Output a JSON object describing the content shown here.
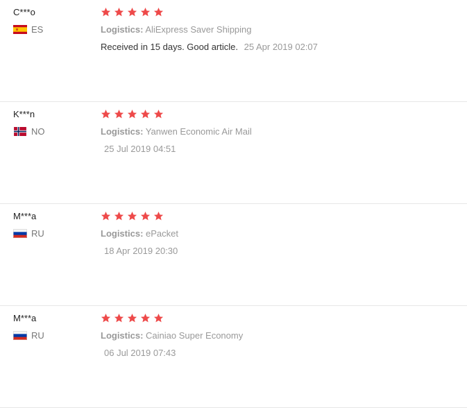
{
  "logistics_label": "Logistics:",
  "star_color": "#ee4a4a",
  "reviews": [
    {
      "user": "C***o",
      "country": "ES",
      "flag": "spain-flag",
      "rating": 5,
      "logistics": "AliExpress Saver Shipping",
      "feedback": "Received in 15 days. Good article.",
      "date": "25 Apr 2019 02:07"
    },
    {
      "user": "K***n",
      "country": "NO",
      "flag": "norway-flag",
      "rating": 5,
      "logistics": "Yanwen Economic Air Mail",
      "feedback": "",
      "date": "25 Jul 2019 04:51"
    },
    {
      "user": "M***a",
      "country": "RU",
      "flag": "russia-flag",
      "rating": 5,
      "logistics": "ePacket",
      "feedback": "",
      "date": "18 Apr 2019 20:30"
    },
    {
      "user": "M***a",
      "country": "RU",
      "flag": "russia-flag",
      "rating": 5,
      "logistics": "Cainiao Super Economy",
      "feedback": "",
      "date": "06 Jul 2019 07:43"
    }
  ]
}
